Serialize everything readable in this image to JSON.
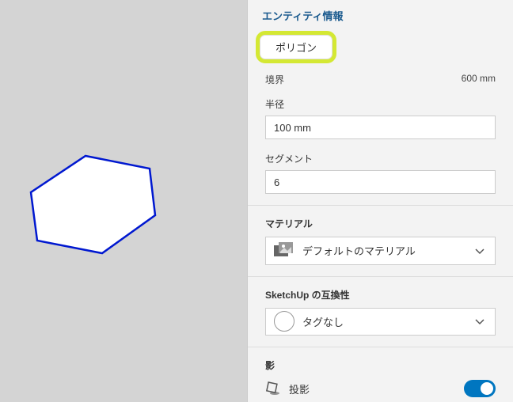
{
  "panel": {
    "title": "エンティティ情報",
    "entity_type": "ポリゴン",
    "boundary": {
      "label": "境界",
      "value": "600 mm"
    },
    "radius": {
      "label": "半径",
      "value": "100 mm"
    },
    "segments": {
      "label": "セグメント",
      "value": "6"
    },
    "material": {
      "label": "マテリアル",
      "selected": "デフォルトのマテリアル"
    },
    "compat": {
      "label": "SketchUp の互換性",
      "tag": "タグなし"
    },
    "shadow": {
      "label": "影",
      "cast_label": "投影",
      "cast_on": true
    }
  }
}
